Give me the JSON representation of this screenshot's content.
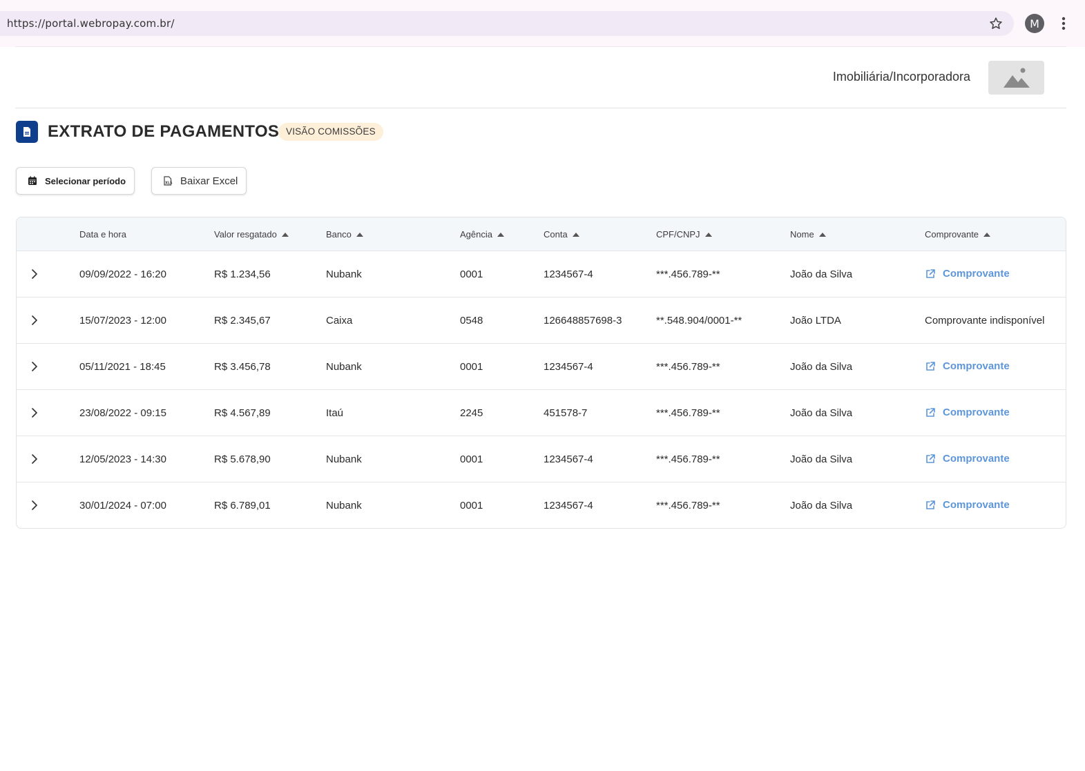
{
  "browser": {
    "url": "https://portal.webropay.com.br/",
    "avatar_letter": "M"
  },
  "header": {
    "company_name": "Imobiliária/Incorporadora"
  },
  "page": {
    "title": "EXTRATO DE PAGAMENTOS",
    "badge": "VISÃO COMISSÕES",
    "accent_color": "#0e3e8c",
    "link_color": "#5d96d8"
  },
  "actions": {
    "select_period": "Selecionar período",
    "download_excel": "Baixar Excel"
  },
  "table": {
    "columns": [
      "Data e hora",
      "Valor resgatado",
      "Banco",
      "Agência",
      "Conta",
      "CPF/CNPJ",
      "Nome",
      "Comprovante"
    ],
    "rows": [
      {
        "date": "09/09/2022 - 16:20",
        "value": "R$ 1.234,56",
        "bank": "Nubank",
        "agency": "0001",
        "account": "1234567-4",
        "doc": "***.456.789-**",
        "name": "João da Silva",
        "receipt": "Comprovante",
        "receipt_available": true
      },
      {
        "date": "15/07/2023 - 12:00",
        "value": "R$ 2.345,67",
        "bank": "Caixa",
        "agency": "0548",
        "account": "126648857698-3",
        "doc": "**.548.904/0001-**",
        "name": "João LTDA",
        "receipt": "Comprovante indisponível",
        "receipt_available": false
      },
      {
        "date": "05/11/2021 - 18:45",
        "value": "R$ 3.456,78",
        "bank": "Nubank",
        "agency": "0001",
        "account": "1234567-4",
        "doc": "***.456.789-**",
        "name": "João da Silva",
        "receipt": "Comprovante",
        "receipt_available": true
      },
      {
        "date": "23/08/2022 - 09:15",
        "value": "R$ 4.567,89",
        "bank": "Itaú",
        "agency": "2245",
        "account": "451578-7",
        "doc": "***.456.789-**",
        "name": "João da Silva",
        "receipt": "Comprovante",
        "receipt_available": true
      },
      {
        "date": "12/05/2023 - 14:30",
        "value": "R$ 5.678,90",
        "bank": "Nubank",
        "agency": "0001",
        "account": "1234567-4",
        "doc": "***.456.789-**",
        "name": "João da Silva",
        "receipt": "Comprovante",
        "receipt_available": true
      },
      {
        "date": "30/01/2024 - 07:00",
        "value": "R$ 6.789,01",
        "bank": "Nubank",
        "agency": "0001",
        "account": "1234567-4",
        "doc": "***.456.789-**",
        "name": "João da Silva",
        "receipt": "Comprovante",
        "receipt_available": true
      }
    ]
  }
}
